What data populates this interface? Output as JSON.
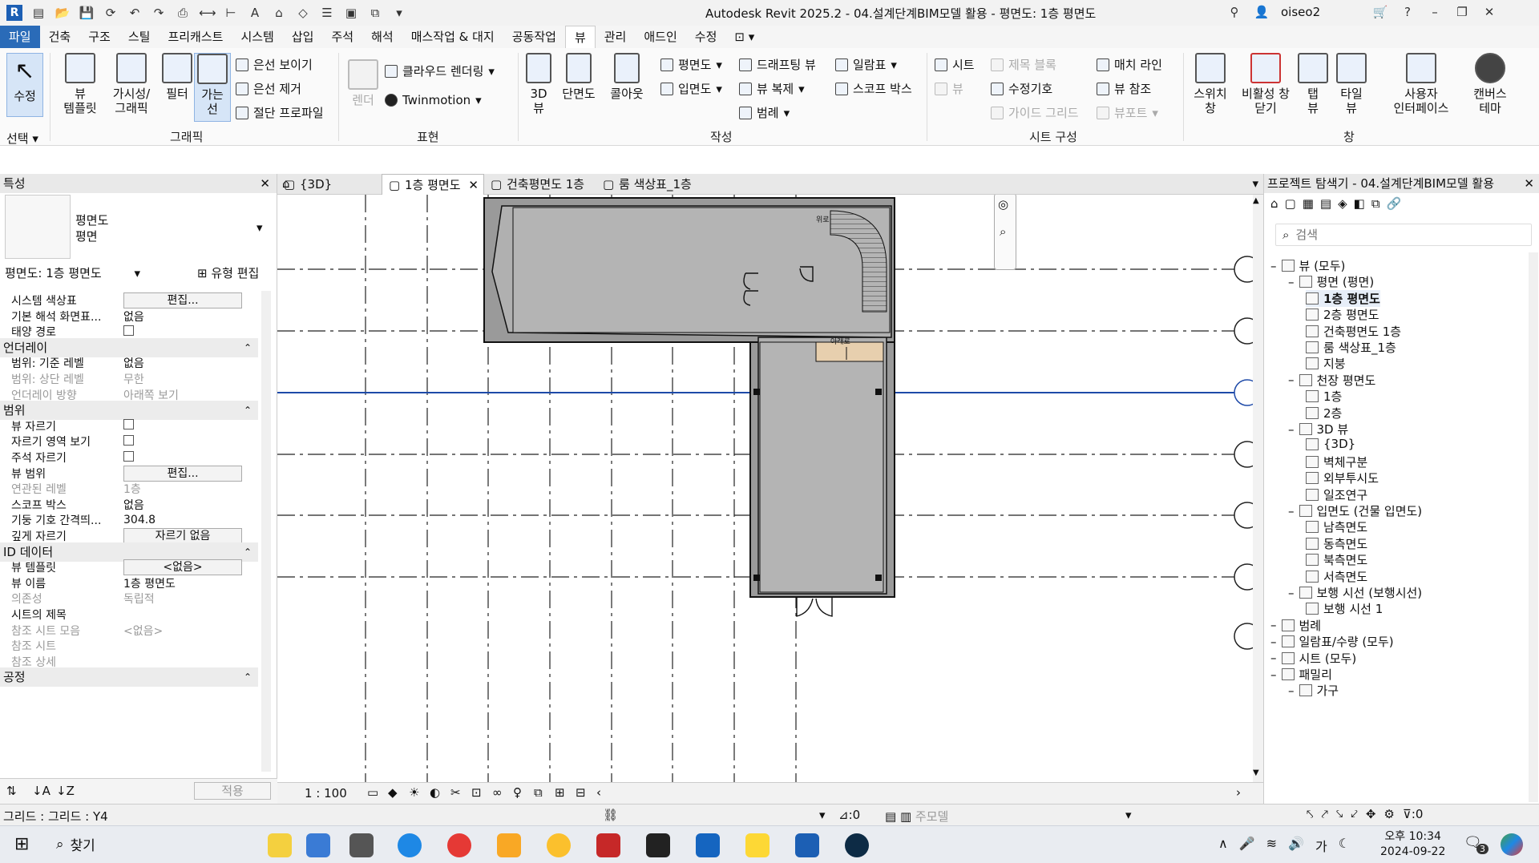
{
  "window": {
    "title": "Autodesk Revit 2025.2 - 04.설계단계BIM모델 활용 - 평면도: 1층 평면도",
    "user": "oiseo2",
    "app_icon": "R"
  },
  "menu": [
    "파일",
    "건축",
    "구조",
    "스틸",
    "프리캐스트",
    "시스템",
    "삽입",
    "주석",
    "해석",
    "매스작업 & 대지",
    "공동작업",
    "뷰",
    "관리",
    "애드인",
    "수정"
  ],
  "ribbon": {
    "select": {
      "modify": "수정",
      "select_label": "선택"
    },
    "graphics": {
      "label": "그래픽",
      "view_template": "뷰\n템플릿",
      "visibility": "가시성/\n그래픽",
      "filters": "필터",
      "thin_lines": "가는\n선",
      "show_hidden": "은선 보이기",
      "remove_hidden": "은선 제거",
      "cut_profile": "절단 프로파일"
    },
    "presentation": {
      "label": "표현",
      "render": "렌더",
      "cloud_render": "클라우드 렌더링",
      "twinmotion": "Twinmotion"
    },
    "create": {
      "label": "작성",
      "view3d": "3D\n뷰",
      "section": "단면도",
      "callout": "콜아웃",
      "plan": "평면도",
      "elevation": "입면도",
      "drafting": "드래프팅 뷰",
      "duplicate": "뷰 복제",
      "legend": "범례",
      "schedule": "일람표",
      "scope_box": "스코프 박스"
    },
    "sheet": {
      "label": "시트 구성",
      "sheet": "시트",
      "title_block": "제목 블록",
      "view": "뷰",
      "revision": "수정기호",
      "guide_grid": "가이드 그리드",
      "match_line": "매치 라인",
      "view_ref": "뷰 참조",
      "viewport": "뷰포트"
    },
    "window": {
      "label": "창",
      "switch": "스위치\n창",
      "close_inactive": "비활성 창\n닫기",
      "tab_views": "탭\n뷰",
      "tile_views": "타일\n뷰",
      "ui": "사용자\n인터페이스",
      "canvas_theme": "캔버스\n테마"
    }
  },
  "properties": {
    "title": "특성",
    "type_name": "평면도",
    "type_sub": "평면",
    "selector": "평면도: 1층 평면도",
    "edit_type": "유형 편집",
    "rows": [
      {
        "k": "시스템 색상표",
        "v": "편집...",
        "kind": "btn"
      },
      {
        "k": "기본 해석 화면표...",
        "v": "없음"
      },
      {
        "k": "태양 경로",
        "v": "",
        "kind": "chk"
      },
      {
        "k": "언더레이",
        "kind": "sec"
      },
      {
        "k": "범위: 기준 레벨",
        "v": "없음"
      },
      {
        "k": "범위: 상단 레벨",
        "v": "무한",
        "dis": true
      },
      {
        "k": "언더레이 방향",
        "v": "아래쪽 보기",
        "dis": true
      },
      {
        "k": "범위",
        "kind": "sec"
      },
      {
        "k": "뷰 자르기",
        "v": "",
        "kind": "chk"
      },
      {
        "k": "자르기 영역 보기",
        "v": "",
        "kind": "chk"
      },
      {
        "k": "주석 자르기",
        "v": "",
        "kind": "chk"
      },
      {
        "k": "뷰 범위",
        "v": "편집...",
        "kind": "btn"
      },
      {
        "k": "연관된 레벨",
        "v": "1층",
        "dis": true
      },
      {
        "k": "스코프 박스",
        "v": "없음"
      },
      {
        "k": "기둥 기호 간격띄...",
        "v": "304.8"
      },
      {
        "k": "깊게 자르기",
        "v": "자르기 없음",
        "kind": "btn"
      },
      {
        "k": "ID 데이터",
        "kind": "sec"
      },
      {
        "k": "뷰 템플릿",
        "v": "<없음>",
        "kind": "btn"
      },
      {
        "k": "뷰 이름",
        "v": "1층 평면도"
      },
      {
        "k": "의존성",
        "v": "독립적",
        "dis": true
      },
      {
        "k": "시트의 제목",
        "v": ""
      },
      {
        "k": "참조 시트 모음",
        "v": "<없음>",
        "dis": true
      },
      {
        "k": "참조 시트",
        "v": "",
        "dis": true
      },
      {
        "k": "참조 상세",
        "v": "",
        "dis": true
      },
      {
        "k": "공정",
        "kind": "sec"
      }
    ],
    "apply": "적용"
  },
  "tabs": [
    {
      "label": "{3D}",
      "active": false
    },
    {
      "label": "1층 평면도",
      "active": true
    },
    {
      "label": "건축평면도 1층",
      "active": false
    },
    {
      "label": "룸 색상표_1층",
      "active": false
    }
  ],
  "plan": {
    "up_label": "위로",
    "down_label": "아래로"
  },
  "viewbar": {
    "scale": "1 : 100"
  },
  "browser": {
    "title": "프로젝트 탐색기 - 04.설계단계BIM모델 활용",
    "search_placeholder": "검색",
    "nodes": [
      {
        "t": "뷰 (모두)",
        "lvl": 0
      },
      {
        "t": "평면 (평면)",
        "lvl": 1
      },
      {
        "t": "1층 평면도",
        "lvl": 2,
        "sel": true
      },
      {
        "t": "2층 평면도",
        "lvl": 2
      },
      {
        "t": "건축평면도 1층",
        "lvl": 2
      },
      {
        "t": "룸 색상표_1층",
        "lvl": 2
      },
      {
        "t": "지붕",
        "lvl": 2
      },
      {
        "t": "천장 평면도",
        "lvl": 1
      },
      {
        "t": "1층",
        "lvl": 2
      },
      {
        "t": "2층",
        "lvl": 2
      },
      {
        "t": "3D 뷰",
        "lvl": 1
      },
      {
        "t": "{3D}",
        "lvl": 2
      },
      {
        "t": "벽체구분",
        "lvl": 2
      },
      {
        "t": "외부투시도",
        "lvl": 2
      },
      {
        "t": "일조연구",
        "lvl": 2
      },
      {
        "t": "입면도 (건물 입면도)",
        "lvl": 1
      },
      {
        "t": "남측면도",
        "lvl": 2
      },
      {
        "t": "동측면도",
        "lvl": 2
      },
      {
        "t": "북측면도",
        "lvl": 2
      },
      {
        "t": "서측면도",
        "lvl": 2
      },
      {
        "t": "보행 시선 (보행시선)",
        "lvl": 1
      },
      {
        "t": "보행 시선 1",
        "lvl": 2
      },
      {
        "t": "범례",
        "lvl": 0
      },
      {
        "t": "일람표/수량 (모두)",
        "lvl": 0
      },
      {
        "t": "시트 (모두)",
        "lvl": 0
      },
      {
        "t": "패밀리",
        "lvl": 0
      },
      {
        "t": "가구",
        "lvl": 1
      }
    ]
  },
  "status": {
    "text": "그리드 : 그리드 : Y4",
    "zero1": ":0",
    "model": "주모델",
    "filter_count": ":0"
  },
  "taskbar": {
    "search": "찾기",
    "time": "오후 10:34",
    "date": "2024-09-22",
    "notif": "3",
    "lang": "가"
  }
}
